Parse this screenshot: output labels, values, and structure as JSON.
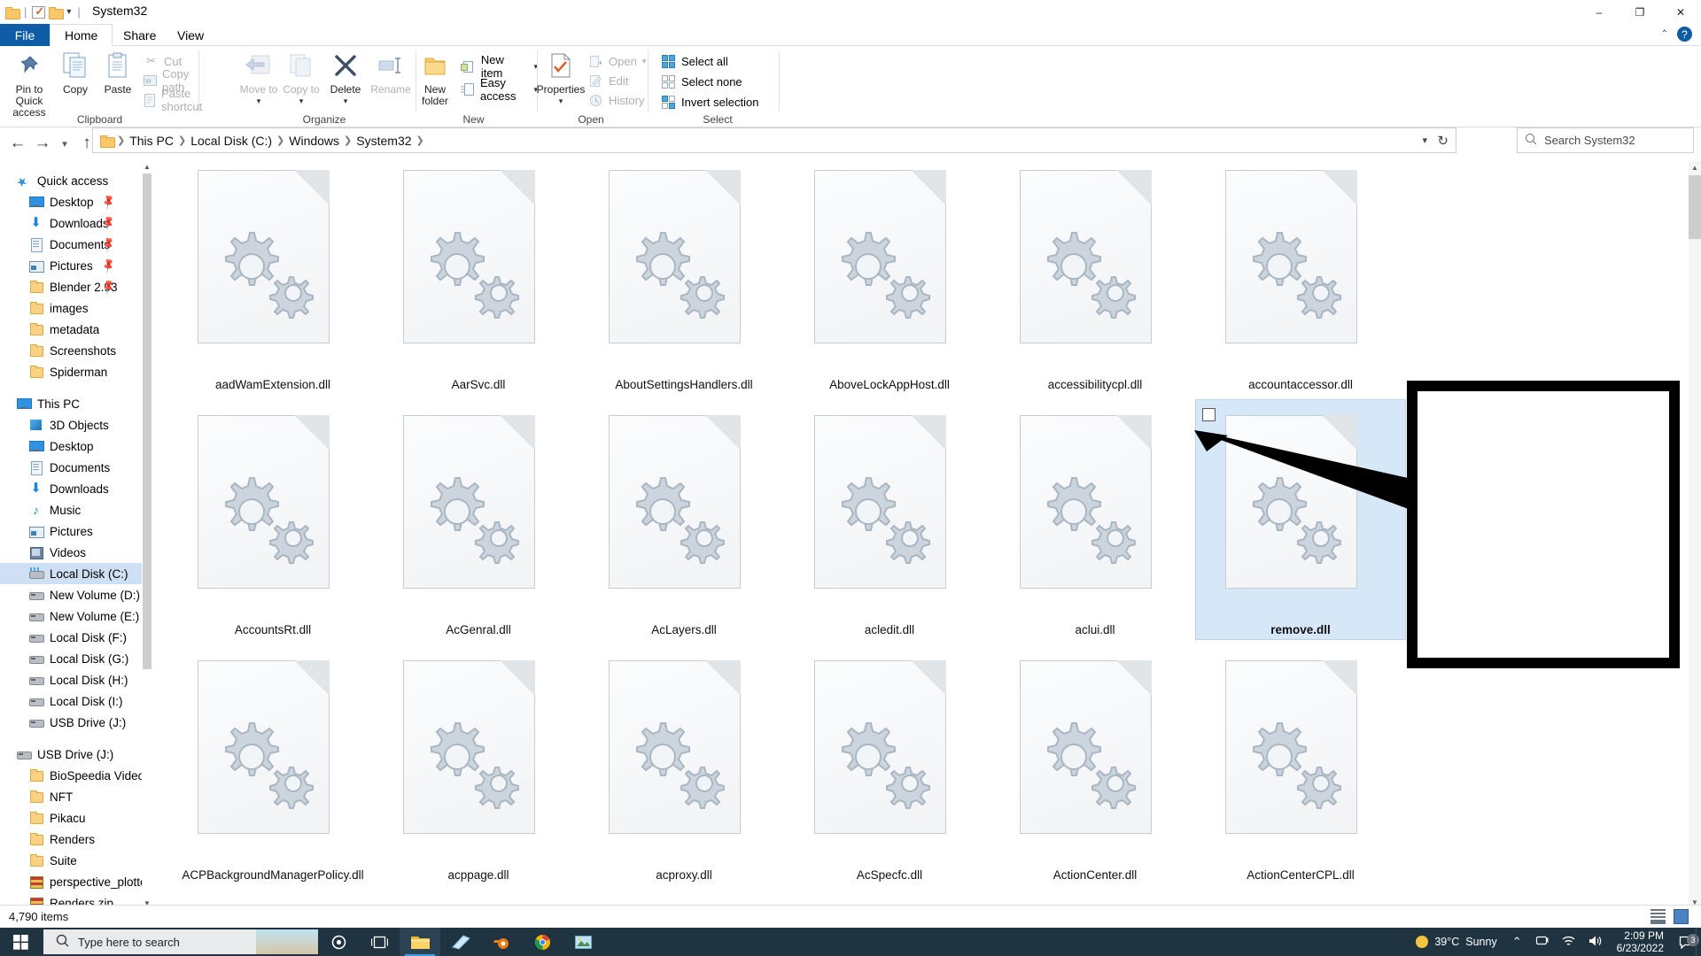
{
  "window": {
    "title": "System32",
    "quick_access_icons": [
      "folder-icon",
      "properties-check-icon",
      "folder-icon",
      "dropdown-arrow-icon"
    ],
    "minimize": "–",
    "maximize": "❐",
    "close": "✕"
  },
  "ribbon": {
    "tabs": [
      {
        "label": "File",
        "id": "file",
        "active": false
      },
      {
        "label": "Home",
        "id": "home",
        "active": true
      },
      {
        "label": "Share",
        "id": "share",
        "active": false
      },
      {
        "label": "View",
        "id": "view",
        "active": false
      }
    ],
    "help_icon": "question-help-icon",
    "collapse_icon": "chevron-up-icon",
    "groups": [
      {
        "name": "Clipboard",
        "big_buttons": [
          {
            "label": "Pin to Quick access",
            "icon": "pin-icon",
            "disabled": false
          },
          {
            "label": "Copy",
            "icon": "copy-icon",
            "disabled": false
          },
          {
            "label": "Paste",
            "icon": "paste-icon",
            "disabled": false
          }
        ],
        "small_buttons": [
          {
            "label": "Cut",
            "icon": "scissors-icon",
            "disabled": true
          },
          {
            "label": "Copy path",
            "icon": "copy-path-icon",
            "disabled": true
          },
          {
            "label": "Paste shortcut",
            "icon": "paste-shortcut-icon",
            "disabled": true
          }
        ]
      },
      {
        "name": "Organize",
        "big_buttons": [
          {
            "label": "Move to",
            "icon": "move-to-icon",
            "disabled": true,
            "dropdown": true
          },
          {
            "label": "Copy to",
            "icon": "copy-to-icon",
            "disabled": true,
            "dropdown": true
          },
          {
            "label": "Delete",
            "icon": "delete-x-icon",
            "disabled": false,
            "dropdown": true
          },
          {
            "label": "Rename",
            "icon": "rename-icon",
            "disabled": true
          }
        ],
        "small_buttons": []
      },
      {
        "name": "New",
        "big_buttons": [
          {
            "label": "New folder",
            "icon": "new-folder-icon",
            "disabled": false
          }
        ],
        "small_buttons": [
          {
            "label": "New item",
            "icon": "new-item-icon",
            "disabled": false,
            "dropdown": true
          },
          {
            "label": "Easy access",
            "icon": "easy-access-icon",
            "disabled": false,
            "dropdown": true
          }
        ]
      },
      {
        "name": "Open",
        "big_buttons": [
          {
            "label": "Properties",
            "icon": "properties-icon",
            "disabled": false,
            "dropdown": true
          }
        ],
        "small_buttons": [
          {
            "label": "Open",
            "icon": "open-icon",
            "disabled": true,
            "dropdown": true
          },
          {
            "label": "Edit",
            "icon": "edit-icon",
            "disabled": true
          },
          {
            "label": "History",
            "icon": "history-icon",
            "disabled": true
          }
        ]
      },
      {
        "name": "Select",
        "big_buttons": [],
        "small_buttons": [
          {
            "label": "Select all",
            "icon": "select-all-icon",
            "disabled": false
          },
          {
            "label": "Select none",
            "icon": "select-none-icon",
            "disabled": false
          },
          {
            "label": "Invert selection",
            "icon": "invert-selection-icon",
            "disabled": false
          }
        ]
      }
    ]
  },
  "addressbar": {
    "back_icon": "back-arrow-icon",
    "forward_icon": "forward-arrow-icon",
    "recent_icon": "chevron-down-icon",
    "up_icon": "up-arrow-icon",
    "breadcrumbs": [
      "This PC",
      "Local Disk (C:)",
      "Windows",
      "System32"
    ],
    "dropdown_icon": "chevron-down-icon",
    "refresh_icon": "refresh-icon"
  },
  "search": {
    "placeholder": "Search System32",
    "icon": "search-icon"
  },
  "navpane": {
    "sections": [
      {
        "header": {
          "label": "Quick access",
          "icon": "star-icon",
          "level": "root"
        },
        "items": [
          {
            "label": "Desktop",
            "icon": "monitor-ic",
            "pinned": true
          },
          {
            "label": "Downloads",
            "icon": "dl-ic",
            "pinned": true
          },
          {
            "label": "Documents",
            "icon": "doc-ic",
            "pinned": true
          },
          {
            "label": "Pictures",
            "icon": "pic-ic",
            "pinned": true
          },
          {
            "label": "Blender 2.93",
            "icon": "folder-ic",
            "pinned": true
          },
          {
            "label": "images",
            "icon": "folder-ic",
            "pinned": false
          },
          {
            "label": "metadata",
            "icon": "folder-ic",
            "pinned": false
          },
          {
            "label": "Screenshots",
            "icon": "folder-ic",
            "pinned": false
          },
          {
            "label": "Spiderman",
            "icon": "folder-ic",
            "pinned": false
          }
        ]
      },
      {
        "header": {
          "label": "This PC",
          "icon": "monitor-ic",
          "level": "root"
        },
        "items": [
          {
            "label": "3D Objects",
            "icon": "obj3d-ic",
            "pinned": false
          },
          {
            "label": "Desktop",
            "icon": "monitor-ic",
            "pinned": false
          },
          {
            "label": "Documents",
            "icon": "doc-ic",
            "pinned": false
          },
          {
            "label": "Downloads",
            "icon": "dl-ic",
            "pinned": false
          },
          {
            "label": "Music",
            "icon": "music-ic",
            "pinned": false
          },
          {
            "label": "Pictures",
            "icon": "pic-ic",
            "pinned": false
          },
          {
            "label": "Videos",
            "icon": "video-ic",
            "pinned": false
          },
          {
            "label": "Local Disk (C:)",
            "icon": "cdrive-ic",
            "pinned": false,
            "selected": true
          },
          {
            "label": "New Volume (D:)",
            "icon": "drive-ic",
            "pinned": false
          },
          {
            "label": "New Volume (E:)",
            "icon": "drive-ic",
            "pinned": false
          },
          {
            "label": "Local Disk (F:)",
            "icon": "drive-ic",
            "pinned": false
          },
          {
            "label": "Local Disk (G:)",
            "icon": "drive-ic",
            "pinned": false
          },
          {
            "label": "Local Disk (H:)",
            "icon": "drive-ic",
            "pinned": false
          },
          {
            "label": "Local Disk (I:)",
            "icon": "drive-ic",
            "pinned": false
          },
          {
            "label": "USB Drive (J:)",
            "icon": "drive-ic",
            "pinned": false
          }
        ]
      },
      {
        "header": {
          "label": "USB Drive (J:)",
          "icon": "drive-ic",
          "level": "root"
        },
        "items": [
          {
            "label": "BioSpeedia Videos",
            "icon": "folder-ic",
            "pinned": false
          },
          {
            "label": "NFT",
            "icon": "folder-ic",
            "pinned": false
          },
          {
            "label": "Pikacu",
            "icon": "folder-ic",
            "pinned": false
          },
          {
            "label": "Renders",
            "icon": "folder-ic",
            "pinned": false
          },
          {
            "label": "Suite",
            "icon": "folder-ic",
            "pinned": false
          },
          {
            "label": "perspective_plotter.v",
            "icon": "zip-ic",
            "pinned": false
          },
          {
            "label": "Renders.zip",
            "icon": "zip-ic",
            "pinned": false
          }
        ]
      }
    ]
  },
  "files": [
    {
      "name": "aadWamExtension.dll",
      "selected": false
    },
    {
      "name": "AarSvc.dll",
      "selected": false
    },
    {
      "name": "AboutSettingsHandlers.dll",
      "selected": false
    },
    {
      "name": "AboveLockAppHost.dll",
      "selected": false
    },
    {
      "name": "accessibilitycpl.dll",
      "selected": false
    },
    {
      "name": "accountaccessor.dll",
      "selected": false
    },
    {
      "name": "AccountsRt.dll",
      "selected": false
    },
    {
      "name": "AcGenral.dll",
      "selected": false
    },
    {
      "name": "AcLayers.dll",
      "selected": false
    },
    {
      "name": "acledit.dll",
      "selected": false
    },
    {
      "name": "aclui.dll",
      "selected": false
    },
    {
      "name": "remove.dll",
      "selected": true
    },
    {
      "name": "ACPBackgroundManagerPolicy.dll",
      "selected": false
    },
    {
      "name": "acppage.dll",
      "selected": false
    },
    {
      "name": "acproxy.dll",
      "selected": false
    },
    {
      "name": "AcSpecfc.dll",
      "selected": false
    },
    {
      "name": "ActionCenter.dll",
      "selected": false
    },
    {
      "name": "ActionCenterCPL.dll",
      "selected": false
    }
  ],
  "annotation": {
    "highlight_target": "remove.dll",
    "box_color": "#000000",
    "arrow_color": "#000000"
  },
  "statusbar": {
    "item_count": "4,790 items",
    "view_details_icon": "details-view-icon",
    "view_icons_icon": "large-icons-view-icon"
  },
  "taskbar": {
    "start_icon": "windows-start-icon",
    "search_placeholder": "Type here to search",
    "search_icon": "search-icon",
    "items": [
      {
        "icon": "cortana-circle-icon",
        "name": "cortana",
        "active": false
      },
      {
        "icon": "task-view-icon",
        "name": "task-view",
        "active": false
      },
      {
        "icon": "file-explorer-icon",
        "name": "file-explorer",
        "active": true
      },
      {
        "icon": "mail-icon",
        "name": "mail",
        "active": false
      },
      {
        "icon": "blender-icon",
        "name": "blender",
        "active": false
      },
      {
        "icon": "chrome-icon",
        "name": "chrome",
        "active": false
      },
      {
        "icon": "photos-icon",
        "name": "photos",
        "active": false
      }
    ],
    "weather": {
      "temp": "39°C",
      "condition": "Sunny",
      "icon": "sun-icon"
    },
    "tray": [
      {
        "icon": "chevron-up-icon",
        "name": "show-hidden-icons"
      },
      {
        "icon": "onedrive-icon",
        "name": "onedrive"
      },
      {
        "icon": "wifi-icon",
        "name": "network"
      },
      {
        "icon": "volume-icon",
        "name": "volume"
      }
    ],
    "clock": {
      "time": "2:09 PM",
      "date": "6/23/2022"
    },
    "notifications": {
      "icon": "notification-icon",
      "count": "3"
    }
  }
}
